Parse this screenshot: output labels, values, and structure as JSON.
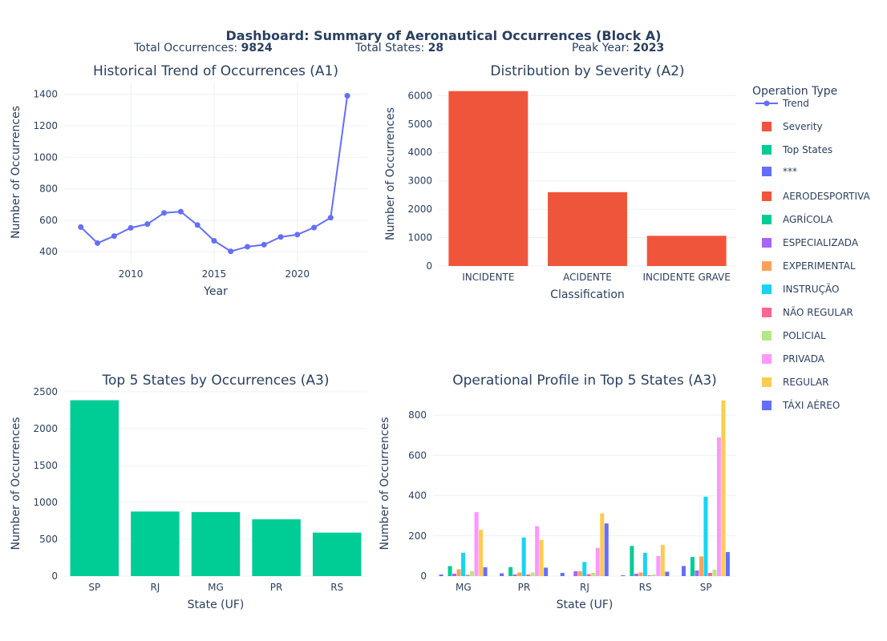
{
  "header": {
    "title": "Dashboard: Summary of Aeronautical Occurrences (Block A)",
    "stat1_label": "Total Occurrences: ",
    "stat1_value": "9824",
    "stat2_label": "Total States: ",
    "stat2_value": "28",
    "stat3_label": "Peak Year: ",
    "stat3_value": "2023"
  },
  "legend": {
    "title": "Operation Type",
    "items": [
      {
        "label": "Trend",
        "color": "#636efa",
        "kind": "line"
      },
      {
        "label": "Severity",
        "color": "#ef553b",
        "kind": "box"
      },
      {
        "label": "Top States",
        "color": "#00cc96",
        "kind": "box"
      },
      {
        "label": "***",
        "color": "#636efa",
        "kind": "box"
      },
      {
        "label": "AERODESPORTIVA",
        "color": "#ef553b",
        "kind": "box"
      },
      {
        "label": "AGRÍCOLA",
        "color": "#00cc96",
        "kind": "box"
      },
      {
        "label": "ESPECIALIZADA",
        "color": "#ab63fa",
        "kind": "box"
      },
      {
        "label": "EXPERIMENTAL",
        "color": "#ffa15a",
        "kind": "box"
      },
      {
        "label": "INSTRUÇÃO",
        "color": "#19d3f3",
        "kind": "box"
      },
      {
        "label": "NÃO REGULAR",
        "color": "#ff6692",
        "kind": "box"
      },
      {
        "label": "POLICIAL",
        "color": "#b6e880",
        "kind": "box"
      },
      {
        "label": "PRIVADA",
        "color": "#ff97ff",
        "kind": "box"
      },
      {
        "label": "REGULAR",
        "color": "#fecb52",
        "kind": "box"
      },
      {
        "label": "TÁXI AÉREO",
        "color": "#636efa",
        "kind": "box"
      }
    ]
  },
  "chart_data": [
    {
      "id": "a1",
      "type": "line",
      "title": "Historical Trend of Occurrences (A1)",
      "xlabel": "Year",
      "ylabel": "Number of Occurrences",
      "color": "#636efa",
      "x": [
        2007,
        2008,
        2009,
        2010,
        2011,
        2012,
        2013,
        2014,
        2015,
        2016,
        2017,
        2018,
        2019,
        2020,
        2021,
        2022,
        2023
      ],
      "y": [
        557,
        455,
        500,
        552,
        576,
        647,
        655,
        570,
        470,
        403,
        432,
        445,
        494,
        509,
        554,
        617,
        1391
      ],
      "xlim": [
        2006,
        2024.2
      ],
      "ylim": [
        330,
        1480
      ],
      "xticks": [
        2010,
        2015,
        2020
      ],
      "yticks": [
        400,
        600,
        800,
        1000,
        1200,
        1400
      ]
    },
    {
      "id": "a2",
      "type": "bar",
      "title": "Distribution by Severity (A2)",
      "xlabel": "Classification",
      "ylabel": "Number of Occurrences",
      "color": "#ef553b",
      "categories": [
        "INCIDENTE",
        "ACIDENTE",
        "INCIDENTE GRAVE"
      ],
      "values": [
        6160,
        2600,
        1064
      ],
      "ylim": [
        0,
        6490
      ],
      "yticks": [
        0,
        1000,
        2000,
        3000,
        4000,
        5000,
        6000
      ]
    },
    {
      "id": "a3",
      "type": "bar",
      "title": "Top 5 States by Occurrences (A3)",
      "xlabel": "State (UF)",
      "ylabel": "Number of Occurrences",
      "color": "#00cc96",
      "categories": [
        "SP",
        "RJ",
        "MG",
        "PR",
        "RS"
      ],
      "values": [
        2385,
        876,
        868,
        770,
        590
      ],
      "ylim": [
        0,
        2510
      ],
      "yticks": [
        0,
        500,
        1000,
        1500,
        2000,
        2500
      ]
    },
    {
      "id": "a4",
      "type": "bar",
      "title": "Operational Profile in Top 5 States (A3)",
      "xlabel": "State (UF)",
      "ylabel": "Number of Occurrences",
      "categories": [
        "MG",
        "PR",
        "RJ",
        "RS",
        "SP"
      ],
      "ylim": [
        0,
        920
      ],
      "yticks": [
        0,
        200,
        400,
        600,
        800
      ],
      "series": [
        {
          "name": "***",
          "color": "#636efa",
          "values": [
            8,
            14,
            16,
            4,
            50
          ]
        },
        {
          "name": "AERODESPORTIVA",
          "color": "#ef553b",
          "values": [
            0,
            0,
            0,
            0,
            0
          ]
        },
        {
          "name": "AGRÍCOLA",
          "color": "#00cc96",
          "values": [
            50,
            45,
            0,
            150,
            95
          ]
        },
        {
          "name": "ESPECIALIZADA",
          "color": "#ab63fa",
          "values": [
            12,
            8,
            24,
            12,
            28
          ]
        },
        {
          "name": "EXPERIMENTAL",
          "color": "#ffa15a",
          "values": [
            34,
            18,
            24,
            18,
            98
          ]
        },
        {
          "name": "INSTRUÇÃO",
          "color": "#19d3f3",
          "values": [
            116,
            192,
            70,
            116,
            395
          ]
        },
        {
          "name": "NÃO REGULAR",
          "color": "#ff6692",
          "values": [
            6,
            8,
            10,
            4,
            16
          ]
        },
        {
          "name": "POLICIAL",
          "color": "#b6e880",
          "values": [
            24,
            18,
            16,
            8,
            32
          ]
        },
        {
          "name": "PRIVADA",
          "color": "#ff97ff",
          "values": [
            318,
            248,
            140,
            100,
            690
          ]
        },
        {
          "name": "REGULAR",
          "color": "#fecb52",
          "values": [
            230,
            180,
            312,
            155,
            873
          ]
        },
        {
          "name": "TÁXI AÉREO",
          "color": "#636efa",
          "values": [
            44,
            42,
            262,
            22,
            120
          ]
        }
      ]
    }
  ]
}
